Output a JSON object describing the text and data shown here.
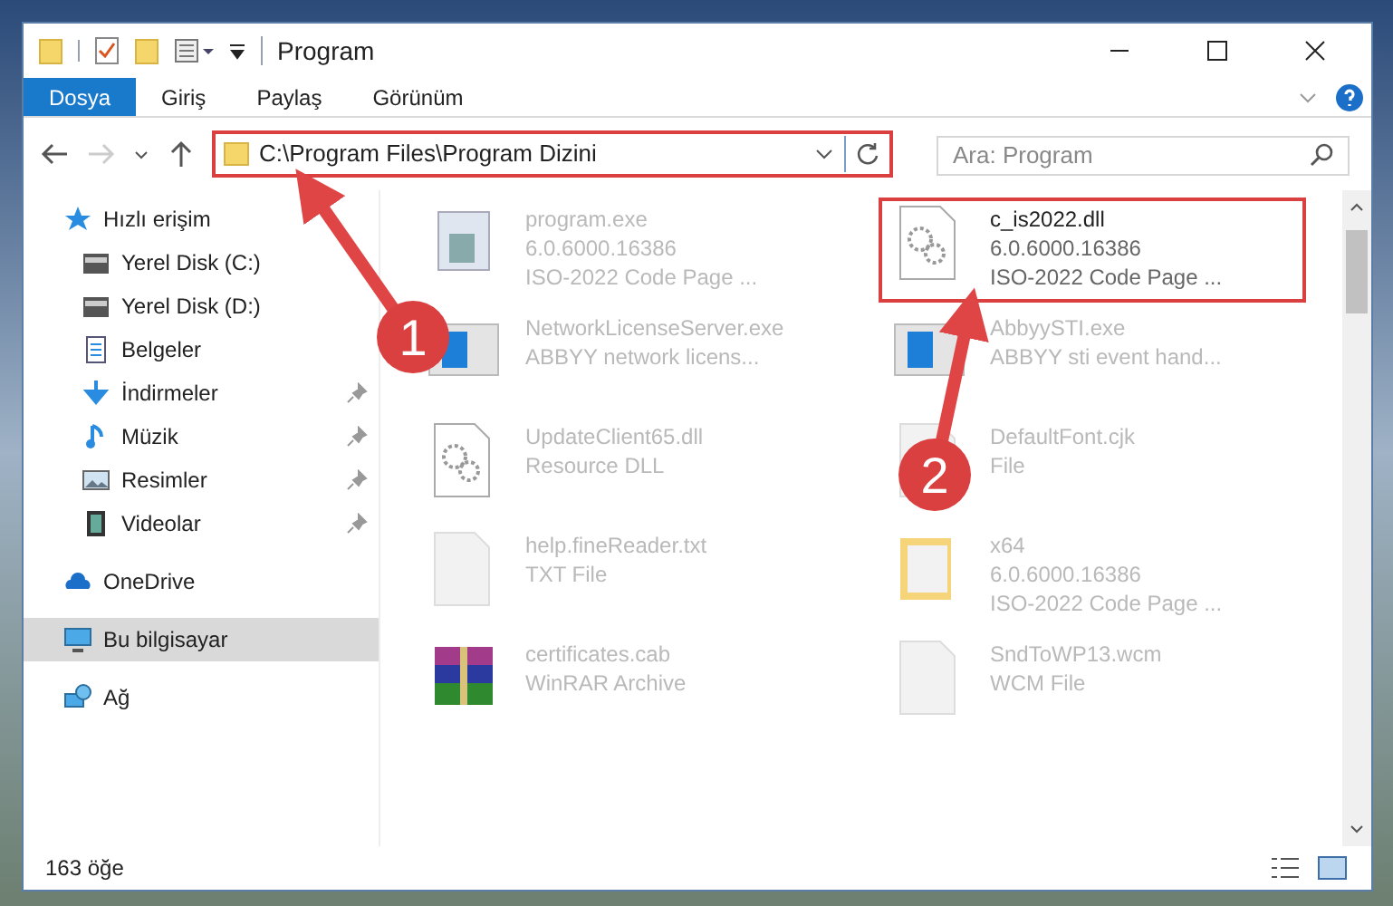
{
  "window": {
    "title": "Program"
  },
  "ribbon_tabs": [
    {
      "label": "Dosya",
      "selected": true
    },
    {
      "label": "Giriş",
      "selected": false
    },
    {
      "label": "Paylaş",
      "selected": false
    },
    {
      "label": "Görünüm",
      "selected": false
    }
  ],
  "address_bar": {
    "path": "C:\\Program Files\\Program Dizini"
  },
  "search": {
    "placeholder": "Ara: Program"
  },
  "sidebar": {
    "items": [
      {
        "label": "Hızlı erişim",
        "pinned": false,
        "selected": false,
        "children": [
          {
            "label": "Yerel Disk (C:)",
            "pinned": false,
            "selected": false
          },
          {
            "label": "Yerel Disk (D:)",
            "pinned": false,
            "selected": false
          },
          {
            "label": "Belgeler",
            "pinned": false,
            "selected": false
          },
          {
            "label": "İndirmeler",
            "pinned": true,
            "selected": false
          },
          {
            "label": "Müzik",
            "pinned": true,
            "selected": false
          },
          {
            "label": "Resimler",
            "pinned": true,
            "selected": false
          },
          {
            "label": "Videolar",
            "pinned": true,
            "selected": false
          }
        ]
      },
      {
        "label": "OneDrive",
        "pinned": false,
        "selected": false
      },
      {
        "label": "Bu bilgisayar",
        "pinned": false,
        "selected": true
      },
      {
        "label": "Ağ",
        "pinned": false,
        "selected": false
      }
    ]
  },
  "files": [
    {
      "name": "program.exe",
      "details": [
        "6.0.6000.16386",
        "ISO-2022 Code Page ..."
      ],
      "kind": "program",
      "highlighted": false
    },
    {
      "name": "c_is2022.dll",
      "details": [
        "6.0.6000.16386",
        "ISO-2022 Code Page ..."
      ],
      "kind": "gear-file",
      "highlighted": true
    },
    {
      "name": "NetworkLicenseServer.exe",
      "details": [
        "ABBYY network licens..."
      ],
      "kind": "app",
      "highlighted": false
    },
    {
      "name": "AbbyySTI.exe",
      "details": [
        "ABBYY sti event hand..."
      ],
      "kind": "app",
      "highlighted": false
    },
    {
      "name": "UpdateClient65.dll",
      "details": [
        "Resource DLL"
      ],
      "kind": "gear-file",
      "highlighted": false
    },
    {
      "name": "DefaultFont.cjk",
      "details": [
        "File"
      ],
      "kind": "file",
      "highlighted": false
    },
    {
      "name": "help.fineReader.txt",
      "details": [
        "TXT File"
      ],
      "kind": "file",
      "highlighted": false
    },
    {
      "name": "x64",
      "details": [
        "6.0.6000.16386",
        "ISO-2022 Code Page ..."
      ],
      "kind": "folder",
      "highlighted": false
    },
    {
      "name": "certificates.cab",
      "details": [
        "WinRAR Archive"
      ],
      "kind": "archive",
      "highlighted": false
    },
    {
      "name": "SndToWP13.wcm",
      "details": [
        "WCM File"
      ],
      "kind": "file",
      "highlighted": false
    }
  ],
  "status_bar": {
    "count": "163 öğe"
  },
  "annotations": [
    {
      "number": "1"
    },
    {
      "number": "2"
    }
  ]
}
